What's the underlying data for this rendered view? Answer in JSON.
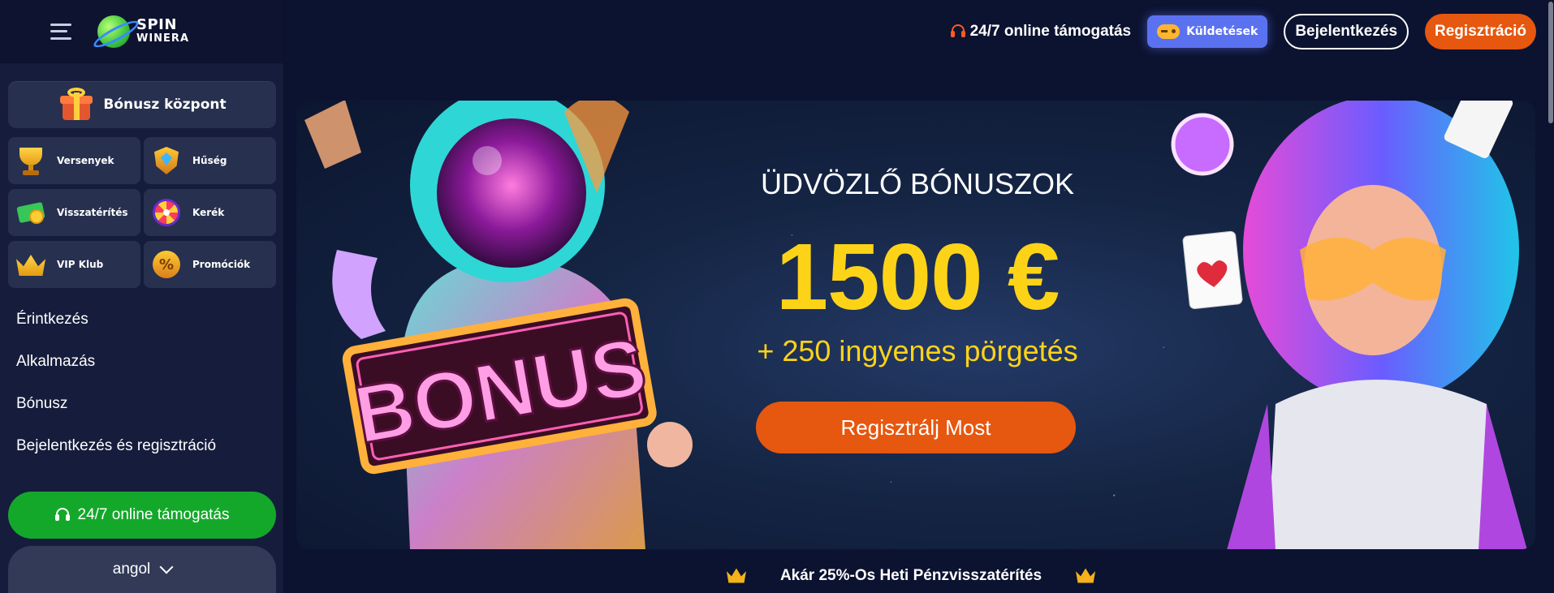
{
  "logo": {
    "line1": "SPIN",
    "line2": "WINERA"
  },
  "sidebar": {
    "bonus_center": "Bónusz központ",
    "grid": [
      {
        "label": "Versenyek",
        "icon": "trophy-icon"
      },
      {
        "label": "Hűség",
        "icon": "shield-icon"
      },
      {
        "label": "Visszatérítés",
        "icon": "cash-icon"
      },
      {
        "label": "Kerék",
        "icon": "wheel-icon"
      },
      {
        "label": "VIP Klub",
        "icon": "crown-icon"
      },
      {
        "label": "Promóciók",
        "icon": "percent-icon"
      }
    ],
    "links": [
      "Érintkezés",
      "Alkalmazás",
      "Bónusz",
      "Bejelentkezés és regisztráció"
    ],
    "support_button": "24/7 online támogatás",
    "language": "angol"
  },
  "header": {
    "support_text": "24/7 online támogatás",
    "missions": "Küldetések",
    "login": "Bejelentkezés",
    "register": "Regisztráció"
  },
  "banner": {
    "heading": "ÜDVÖZLŐ BÓNUSZOK",
    "amount": "1500 €",
    "spins": "+ 250 ingyenes pörgetés",
    "cta": "Regisztrálj Most",
    "sign_text": "BONUS"
  },
  "cashback": "Akár 25%-Os Heti Pénzvisszatérítés",
  "colors": {
    "accent_orange": "#e6570f",
    "accent_yellow": "#fdd318",
    "support_green": "#14a82b",
    "missions_blue": "#5b72f0",
    "background": "#0c1330"
  }
}
